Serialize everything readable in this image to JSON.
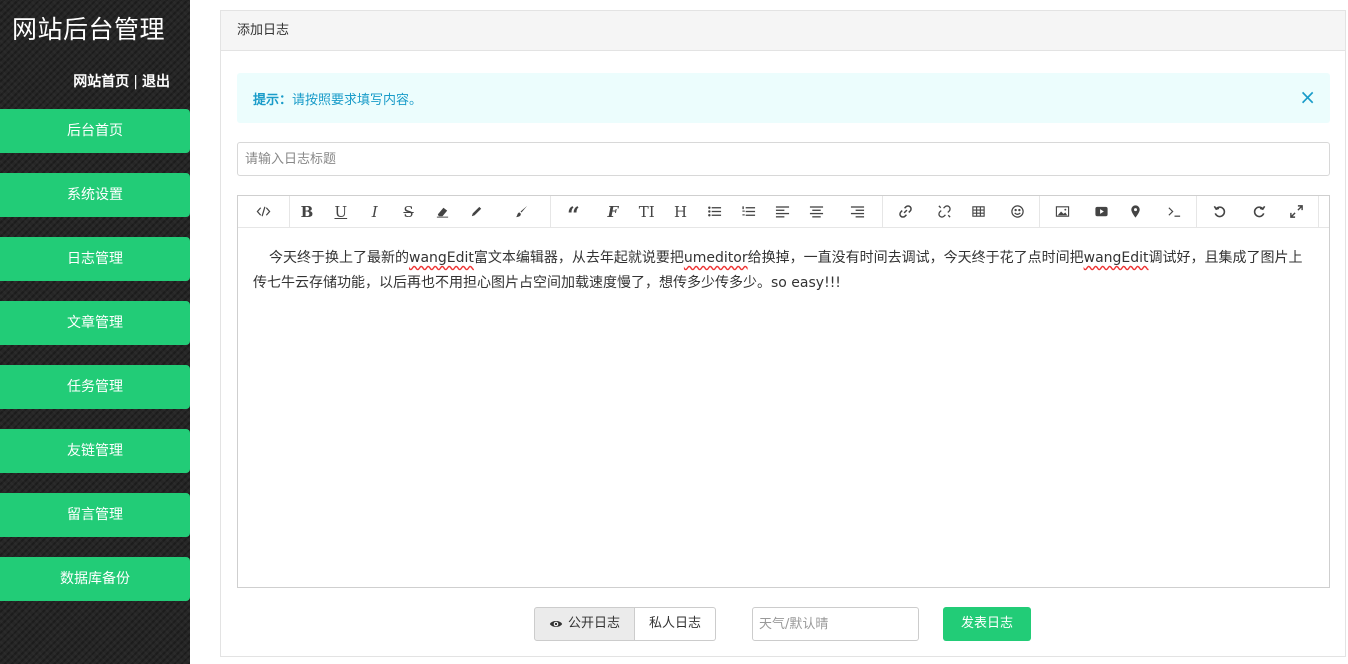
{
  "sidebar": {
    "site_title": "网站后台管理",
    "link_home": "网站首页",
    "separator": "|",
    "link_logout": "退出",
    "items": [
      {
        "label": "后台首页"
      },
      {
        "label": "系统设置"
      },
      {
        "label": "日志管理"
      },
      {
        "label": "文章管理"
      },
      {
        "label": "任务管理"
      },
      {
        "label": "友链管理"
      },
      {
        "label": "留言管理"
      },
      {
        "label": "数据库备份"
      }
    ]
  },
  "panel": {
    "title": "添加日志",
    "alert": {
      "label": "提示：",
      "message": "请按照要求填写内容。",
      "close_icon": "×"
    },
    "title_input": {
      "placeholder": "请输入日志标题",
      "value": ""
    },
    "editor": {
      "toolbar_icons": [
        "code-icon",
        "bold-icon",
        "underline-icon",
        "italic-icon",
        "strikethrough-icon",
        "eraser-icon",
        "pencil-icon",
        "brush-icon",
        "quote-icon",
        "font-family-icon",
        "font-size-icon",
        "header-icon",
        "unordered-list-icon",
        "ordered-list-icon",
        "align-left-icon",
        "align-center-icon",
        "align-right-icon",
        "link-icon",
        "unlink-icon",
        "table-icon",
        "emoticon-icon",
        "image-icon",
        "video-icon",
        "location-icon",
        "terminal-icon",
        "undo-icon",
        "redo-icon",
        "fullscreen-icon"
      ],
      "content": {
        "part1": "今天终于换上了最新的",
        "part2": "wangEdit",
        "part3": "富文本编辑器，从去年起就说要把",
        "part4": "umeditor",
        "part5": "给换掉，一直没有时间去调试，今天终于花了点时间把",
        "part6": "wangEdit",
        "part7": "调试好，且集成了图片上传七牛云存储功能，以后再也不用担心图片占空间加载速度慢了，想传多少传多少。so easy!!!"
      }
    },
    "footer": {
      "public_label": "公开日志",
      "private_label": "私人日志",
      "weather_placeholder": "天气/默认晴",
      "submit_label": "发表日志"
    }
  },
  "colors": {
    "accent": "#22cc77",
    "alert_bg": "#ecfdfd",
    "alert_text": "#1a9cc9",
    "sidebar_bg": "#262626"
  }
}
